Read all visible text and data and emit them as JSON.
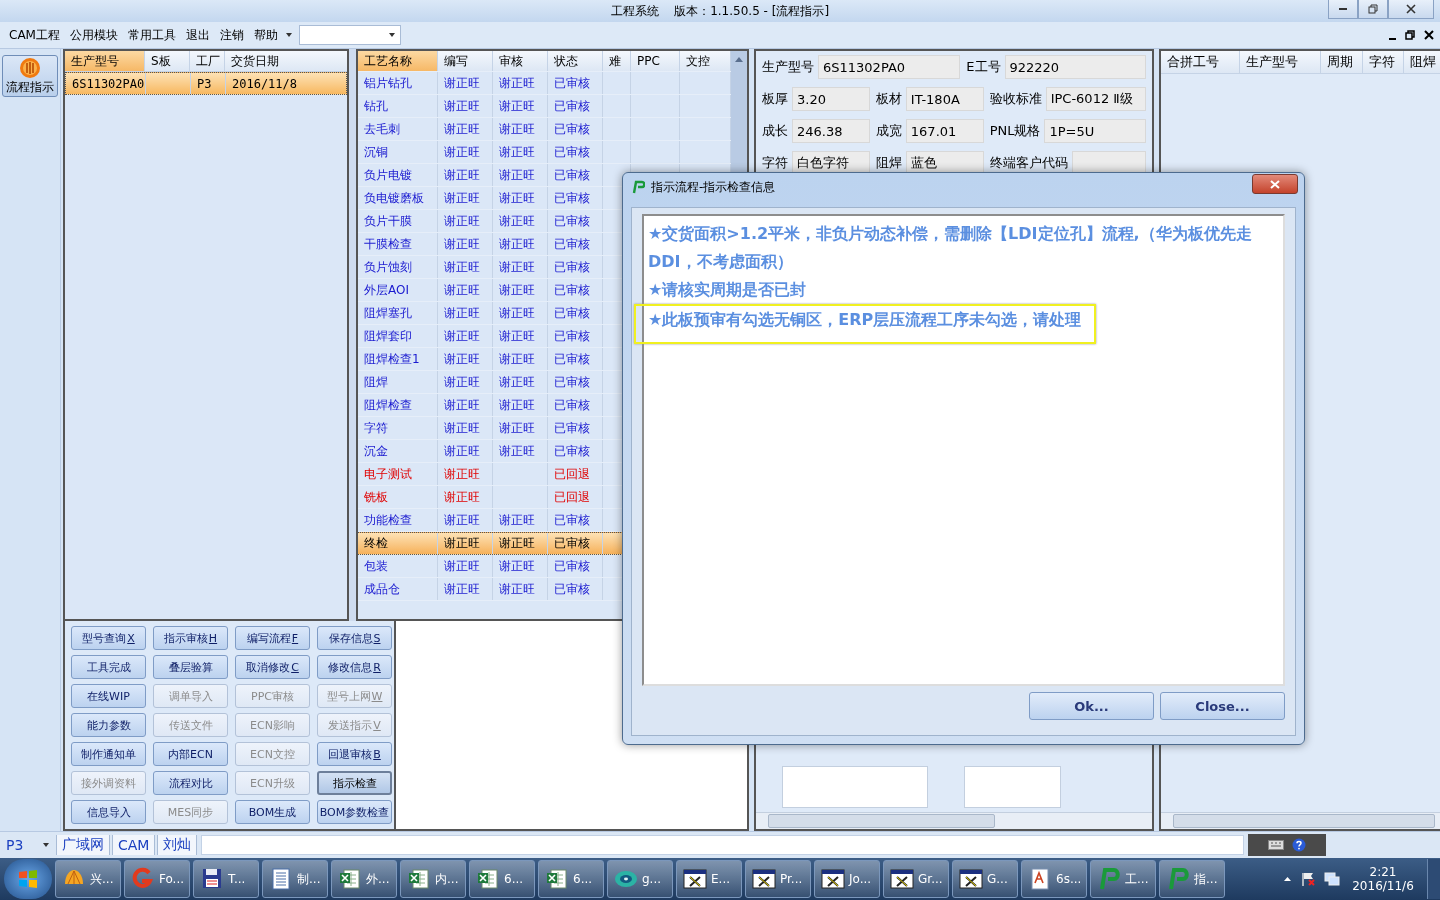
{
  "window": {
    "title": "工程系统    版本：1.1.50.5 - [流程指示]"
  },
  "menu": [
    "CAM工程",
    "公用模块",
    "常用工具",
    "退出",
    "注销",
    "帮助"
  ],
  "toolbar": [
    {
      "label": "流程指示",
      "selected": true
    }
  ],
  "model_table": {
    "columns": [
      "生产型号",
      "S板",
      "工厂",
      "交货日期"
    ],
    "rows": [
      {
        "model": "6S11302PA0",
        "factory": "P3",
        "date": "2016/11/8",
        "selected": true
      }
    ]
  },
  "process_table": {
    "columns": [
      "工艺名称",
      "编写",
      "审核",
      "状态",
      "难",
      "PPC",
      "文控"
    ],
    "rows": [
      {
        "name": "铝片钻孔",
        "writer": "谢正旺",
        "reviewer": "谢正旺",
        "status": "已审核",
        "returned": false,
        "selected": false
      },
      {
        "name": "钻孔",
        "writer": "谢正旺",
        "reviewer": "谢正旺",
        "status": "已审核",
        "returned": false,
        "selected": false
      },
      {
        "name": "去毛刺",
        "writer": "谢正旺",
        "reviewer": "谢正旺",
        "status": "已审核",
        "returned": false,
        "selected": false
      },
      {
        "name": "沉铜",
        "writer": "谢正旺",
        "reviewer": "谢正旺",
        "status": "已审核",
        "returned": false,
        "selected": false
      },
      {
        "name": "负片电镀",
        "writer": "谢正旺",
        "reviewer": "谢正旺",
        "status": "已审核",
        "returned": false,
        "selected": false
      },
      {
        "name": "负电镀磨板",
        "writer": "谢正旺",
        "reviewer": "谢正旺",
        "status": "已审核",
        "returned": false,
        "selected": false
      },
      {
        "name": "负片干膜",
        "writer": "谢正旺",
        "reviewer": "谢正旺",
        "status": "已审核",
        "returned": false,
        "selected": false
      },
      {
        "name": "干膜检查",
        "writer": "谢正旺",
        "reviewer": "谢正旺",
        "status": "已审核",
        "returned": false,
        "selected": false
      },
      {
        "name": "负片蚀刻",
        "writer": "谢正旺",
        "reviewer": "谢正旺",
        "status": "已审核",
        "returned": false,
        "selected": false
      },
      {
        "name": "外层AOI",
        "writer": "谢正旺",
        "reviewer": "谢正旺",
        "status": "已审核",
        "returned": false,
        "selected": false
      },
      {
        "name": "阻焊塞孔",
        "writer": "谢正旺",
        "reviewer": "谢正旺",
        "status": "已审核",
        "returned": false,
        "selected": false
      },
      {
        "name": "阻焊套印",
        "writer": "谢正旺",
        "reviewer": "谢正旺",
        "status": "已审核",
        "returned": false,
        "selected": false
      },
      {
        "name": "阻焊检查1",
        "writer": "谢正旺",
        "reviewer": "谢正旺",
        "status": "已审核",
        "returned": false,
        "selected": false
      },
      {
        "name": "阻焊",
        "writer": "谢正旺",
        "reviewer": "谢正旺",
        "status": "已审核",
        "returned": false,
        "selected": false
      },
      {
        "name": "阻焊检查",
        "writer": "谢正旺",
        "reviewer": "谢正旺",
        "status": "已审核",
        "returned": false,
        "selected": false
      },
      {
        "name": "字符",
        "writer": "谢正旺",
        "reviewer": "谢正旺",
        "status": "已审核",
        "returned": false,
        "selected": false
      },
      {
        "name": "沉金",
        "writer": "谢正旺",
        "reviewer": "谢正旺",
        "status": "已审核",
        "returned": false,
        "selected": false
      },
      {
        "name": "电子测试",
        "writer": "谢正旺",
        "status": "已回退",
        "returned": true,
        "selected": false
      },
      {
        "name": "铣板",
        "writer": "谢正旺",
        "status": "已回退",
        "returned": true,
        "selected": false
      },
      {
        "name": "功能检查",
        "writer": "谢正旺",
        "reviewer": "谢正旺",
        "status": "已审核",
        "returned": false,
        "selected": false
      },
      {
        "name": "终检",
        "writer": "谢正旺",
        "reviewer": "谢正旺",
        "status": "已审核",
        "returned": false,
        "selected": true
      },
      {
        "name": "包装",
        "writer": "谢正旺",
        "reviewer": "谢正旺",
        "status": "已审核",
        "returned": false,
        "selected": false
      },
      {
        "name": "成品仓",
        "writer": "谢正旺",
        "reviewer": "谢正旺",
        "status": "已审核",
        "returned": false,
        "selected": false
      }
    ]
  },
  "action_buttons": [
    {
      "label": "型号查询",
      "shortcut": "X",
      "disabled": false,
      "focused": false
    },
    {
      "label": "指示审核",
      "shortcut": "H",
      "disabled": false,
      "focused": false
    },
    {
      "label": "编写流程",
      "shortcut": "F",
      "disabled": false,
      "focused": false
    },
    {
      "label": "保存信息",
      "shortcut": "S",
      "disabled": false,
      "focused": false
    },
    {
      "label": "工具完成",
      "disabled": false,
      "focused": false
    },
    {
      "label": "叠层验算",
      "disabled": false,
      "focused": false
    },
    {
      "label": "取消修改",
      "shortcut": "C",
      "disabled": false,
      "focused": false
    },
    {
      "label": "修改信息",
      "shortcut": "R",
      "disabled": false,
      "focused": false
    },
    {
      "label": "在线WIP",
      "disabled": false,
      "focused": false
    },
    {
      "label": "调单导入",
      "disabled": true,
      "focused": false
    },
    {
      "label": "PPC审核",
      "disabled": true,
      "focused": false
    },
    {
      "label": "型号上网",
      "shortcut": "W",
      "disabled": true,
      "focused": false
    },
    {
      "label": "能力参数",
      "disabled": false,
      "focused": false
    },
    {
      "label": "传送文件",
      "disabled": true,
      "focused": false
    },
    {
      "label": "ECN影响",
      "disabled": true,
      "focused": false
    },
    {
      "label": "发送指示",
      "shortcut": "V",
      "disabled": true,
      "focused": false
    },
    {
      "label": "制作通知单",
      "disabled": false,
      "focused": false
    },
    {
      "label": "内部ECN",
      "disabled": false,
      "focused": false
    },
    {
      "label": "ECN文控",
      "disabled": true,
      "focused": false
    },
    {
      "label": "回退审核",
      "shortcut": "B",
      "disabled": false,
      "focused": false
    },
    {
      "label": "接外调资料",
      "disabled": true,
      "focused": false
    },
    {
      "label": "流程对比",
      "disabled": false,
      "focused": false
    },
    {
      "label": "ECN升级",
      "disabled": true,
      "focused": false
    },
    {
      "label": "指示检查",
      "disabled": false,
      "focused": true
    },
    {
      "label": "信息导入",
      "disabled": false,
      "focused": false
    },
    {
      "label": "MES同步",
      "disabled": true,
      "focused": false
    },
    {
      "label": "BOM生成",
      "disabled": false,
      "focused": false
    },
    {
      "label": "BOM参数检查",
      "disabled": false,
      "focused": false
    }
  ],
  "info_form": [
    [
      {
        "label": "生产型号",
        "value": "6S11302PA0"
      },
      {
        "label": "E工号",
        "value": "922220"
      }
    ],
    [
      {
        "label": "板厚",
        "value": "3.20"
      },
      {
        "label": "板材",
        "value": "IT-180A"
      },
      {
        "label": "验收标准",
        "value": "IPC-6012 Ⅱ级"
      }
    ],
    [
      {
        "label": "成长",
        "value": "246.38"
      },
      {
        "label": "成宽",
        "value": "167.01"
      },
      {
        "label": "PNL规格",
        "value": "1P=5U"
      }
    ],
    [
      {
        "label": "字符",
        "value": "白色字符"
      },
      {
        "label": "阻焊",
        "value": "蓝色"
      },
      {
        "label": "终端客户代码"
      }
    ]
  ],
  "merge_table": {
    "columns": [
      "合拼工号",
      "生产型号",
      "周期",
      "字符",
      "阻焊"
    ]
  },
  "status_bar": {
    "factory": "P3",
    "tabs": [
      "广域网",
      "CAM",
      "刘灿"
    ]
  },
  "dialog": {
    "title": "指示流程-指示检查信息",
    "messages": [
      {
        "text": "★交货面积>1.2平米，非负片动态补偿，需删除【LDI定位孔】流程,（华为板优先走DDI，不考虑面积）",
        "highlighted": false
      },
      {
        "text": "★请核实周期是否已封",
        "highlighted": false
      },
      {
        "text": "★此板预审有勾选无铜区，ERP层压流程工序未勾选，请处理",
        "highlighted": true
      }
    ],
    "buttons": [
      "Ok...",
      "Close..."
    ]
  },
  "taskbar": {
    "items": [
      {
        "label": "兴...",
        "kind": "shell"
      },
      {
        "label": "Fo...",
        "kind": "arc"
      },
      {
        "label": "T...",
        "kind": "floppy"
      },
      {
        "label": "制...",
        "kind": "notepad"
      },
      {
        "label": "外...",
        "kind": "sheet"
      },
      {
        "label": "内...",
        "kind": "sheet"
      },
      {
        "label": "6...",
        "kind": "sheet"
      },
      {
        "label": "6...",
        "kind": "sheet"
      },
      {
        "label": "g...",
        "kind": "disc"
      },
      {
        "label": "E...",
        "kind": "window"
      },
      {
        "label": "Pr...",
        "kind": "window"
      },
      {
        "label": "Jo...",
        "kind": "window"
      },
      {
        "label": "Gr...",
        "kind": "window"
      },
      {
        "label": "G...",
        "kind": "window"
      },
      {
        "label": "6s...",
        "kind": "doc"
      },
      {
        "label": "工...",
        "kind": "app"
      },
      {
        "label": "指...",
        "kind": "app"
      }
    ],
    "time": "2:21",
    "date": "2016/11/6"
  }
}
